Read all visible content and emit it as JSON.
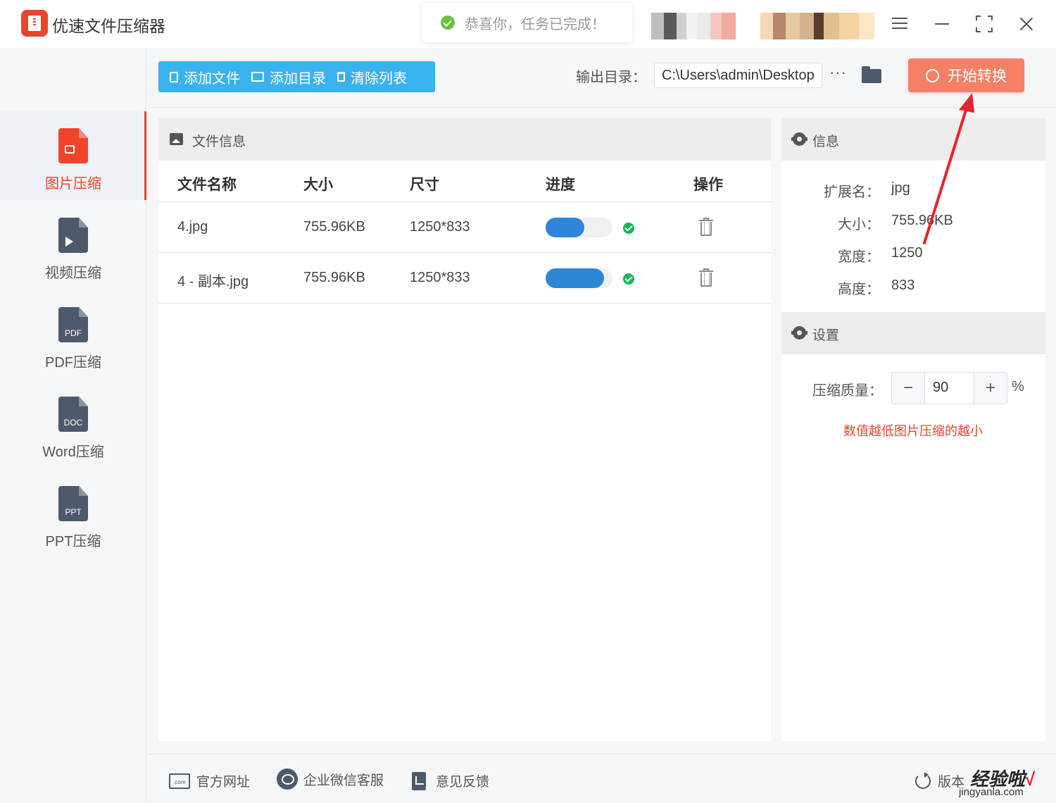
{
  "app": {
    "title": "优速文件压缩器"
  },
  "toast": {
    "message": "恭喜你，任务已完成！"
  },
  "sidebar": {
    "items": [
      {
        "label": "图片压缩",
        "active": true
      },
      {
        "label": "视频压缩",
        "active": false
      },
      {
        "label": "PDF压缩",
        "tag": "PDF",
        "active": false
      },
      {
        "label": "Word压缩",
        "tag": "DOC",
        "active": false
      },
      {
        "label": "PPT压缩",
        "tag": "PPT",
        "active": false
      }
    ]
  },
  "toolbar": {
    "add_file": "添加文件",
    "add_folder": "添加目录",
    "clear_list": "清除列表",
    "output_label": "输出目录：",
    "output_path": "C:\\Users\\admin\\Desktop",
    "more": "···",
    "start": "开始转换"
  },
  "file_panel": {
    "title": "文件信息",
    "columns": [
      "文件名称",
      "大小",
      "尺寸",
      "进度",
      "操作"
    ],
    "rows": [
      {
        "name": "4.jpg",
        "size": "755.96KB",
        "dimensions": "1250*833",
        "progress": 0.58,
        "done": true
      },
      {
        "name": "4 - 副本.jpg",
        "size": "755.96KB",
        "dimensions": "1250*833",
        "progress": 0.87,
        "done": true
      }
    ]
  },
  "info_panel": {
    "title": "信息",
    "fields": [
      {
        "label": "扩展名：",
        "value": "jpg"
      },
      {
        "label": "大小：",
        "value": "755.96KB"
      },
      {
        "label": "宽度：",
        "value": "1250"
      },
      {
        "label": "高度：",
        "value": "833"
      }
    ]
  },
  "settings": {
    "title": "设置",
    "quality_label": "压缩质量：",
    "quality_value": "90",
    "minus": "−",
    "plus": "+",
    "unit": "%",
    "hint": "数值越低图片压缩的越小"
  },
  "footer": {
    "website": "官方网址",
    "website_icon_text": ".com",
    "wechat": "企业微信客服",
    "feedback": "意见反馈",
    "version": "版本"
  },
  "watermark": {
    "text": "经验啦",
    "check": "√",
    "url": "jingyanla.com"
  },
  "colors": {
    "accent": "#e8452e",
    "toolbar": "#3ab2f0",
    "start": "#f58066",
    "progress": "#2d86d8",
    "success": "#1bb55c"
  }
}
